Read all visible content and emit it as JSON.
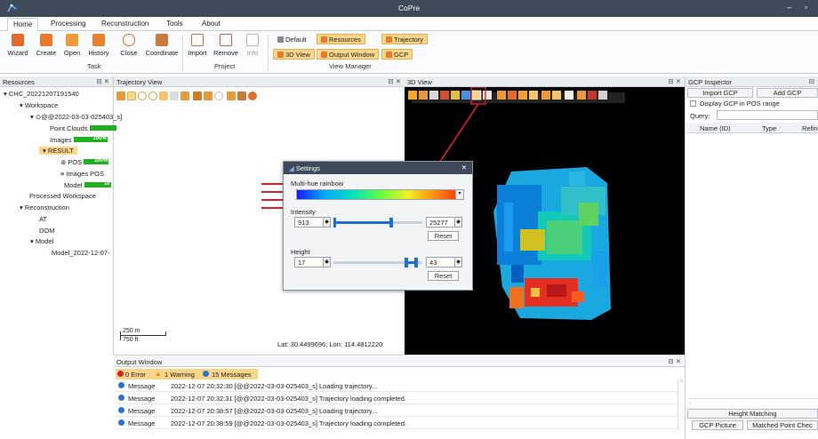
{
  "app": {
    "title": "CoPre"
  },
  "tabs": [
    "Home",
    "Processing",
    "Reconstruction",
    "Tools",
    "About"
  ],
  "ribbon": {
    "task": {
      "buttons": [
        "Wizard",
        "Create",
        "Open",
        "History",
        "Close",
        "Coordinate"
      ],
      "label": "Task"
    },
    "project": {
      "buttons": [
        "Import",
        "Remove",
        "Info"
      ],
      "label": "Project"
    },
    "view": {
      "buttons": [
        "Default",
        "Resources",
        "Trajectory",
        "3D View",
        "Output Window",
        "GCP"
      ],
      "label": "View Manager"
    }
  },
  "resources": {
    "title": "Resources",
    "root": "CHC_20221207191540",
    "workspace": "Workspace",
    "dataset": "@@2022-03-03-025403_s]",
    "point_clouds": "Point Clouds",
    "images": "Images",
    "images_pct": "100%",
    "result": "RESULT",
    "pos": "POS",
    "pos_pct": "100%",
    "images_pos": "Images POS",
    "model": "Model",
    "model_pct": "10",
    "processed": "Processed Workspace",
    "reconstruction": "Reconstruction",
    "at": "AT",
    "dom": "DOM",
    "model2": "Model",
    "model_item": "Model_2022-12-07-"
  },
  "trajectory": {
    "title": "Trajectory View",
    "scale_m": "250 m",
    "scale_ft": "750 ft",
    "coords": "Lat: 30.4499696; Lon: 114.4812220"
  },
  "view3d": {
    "title": "3D View"
  },
  "settings": {
    "title": "Settings",
    "colormap": "Multi-hue rainbow",
    "intensity_label": "Intensity",
    "intensity_min": "913",
    "intensity_max": "25277",
    "height_label": "Height",
    "height_min": "17",
    "height_max": "43",
    "reset": "Reset"
  },
  "gcp": {
    "title": "GCP Inspector",
    "import": "Import GCP",
    "add": "Add GCP",
    "display_label": "Display GCP in POS range",
    "query": "Query:",
    "cols": [
      "Name (ID)",
      "Type",
      "Refin"
    ],
    "height_matching": "Height Matching",
    "gcp_picture": "GCP Picture",
    "matched": "Matched Point Chec"
  },
  "output": {
    "title": "Output Window",
    "errors": "0 Error",
    "warnings": "1 Warning",
    "messages": "15 Messages",
    "rows": [
      {
        "type": "Message",
        "text": "2022-12-07 20:32:30  [@@2022-03-03-025403_s] Loading trajectory..."
      },
      {
        "type": "Message",
        "text": "2022-12-07 20:32:31  [@@2022-03-03-025403_s] Trajectory loading completed."
      },
      {
        "type": "Message",
        "text": "2022-12-07 20:38:57  [@@2022-03-03-025403_s] Loading trajectory..."
      },
      {
        "type": "Message",
        "text": "2022-12-07 20:38:59  [@@2022-03-03-025403_s] Trajectory loading completed."
      }
    ]
  },
  "colors": {
    "titlebar": "#3e4a5a",
    "accent": "#fbd58a",
    "progress": "#1fb01f",
    "annotation": "#d9202b"
  }
}
